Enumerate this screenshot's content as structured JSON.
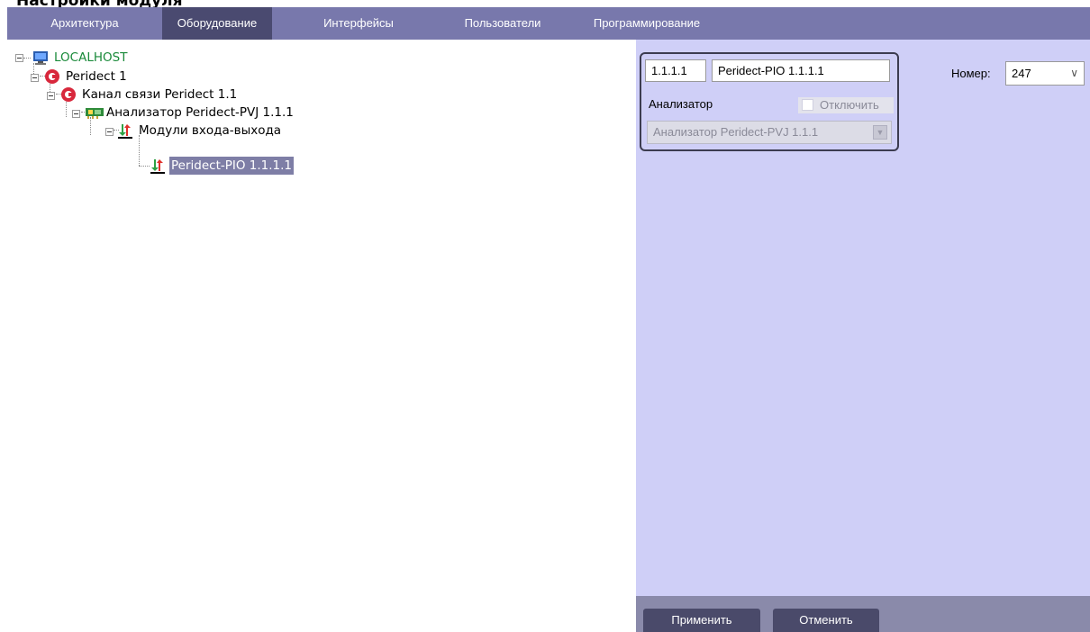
{
  "caption_cut": "Настройки модуля",
  "tabs": [
    {
      "label": "Архитектура"
    },
    {
      "label": "Оборудование"
    },
    {
      "label": "Интерфейсы"
    },
    {
      "label": "Пользователи"
    },
    {
      "label": "Программирование"
    }
  ],
  "active_tab": "Оборудование",
  "tree": {
    "root": "LOCALHOST",
    "device": "Peridect 1",
    "channel": "Канал связи Peridect 1.1",
    "analyzer": "Анализатор Peridect-PVJ 1.1.1",
    "modules": "Модули входа-выхода",
    "module": "Peridect-PIO 1.1.1.1"
  },
  "props": {
    "id_value": "1.1.1.1",
    "name_value": "Peridect-PIO 1.1.1.1",
    "analyzer_label": "Анализатор",
    "disable_label": "Отключить",
    "analyzer_value": "Анализатор Peridect-PVJ 1.1.1",
    "number_label": "Номер:",
    "number_value": "247"
  },
  "buttons": {
    "apply": "Применить",
    "cancel": "Отменить"
  },
  "colors": {
    "tabbar": "#7878ac",
    "tab_active": "#4a4a70",
    "panel": "#cfcff7",
    "selection": "#7e7ea6",
    "root_text": "#1a8a3a"
  }
}
